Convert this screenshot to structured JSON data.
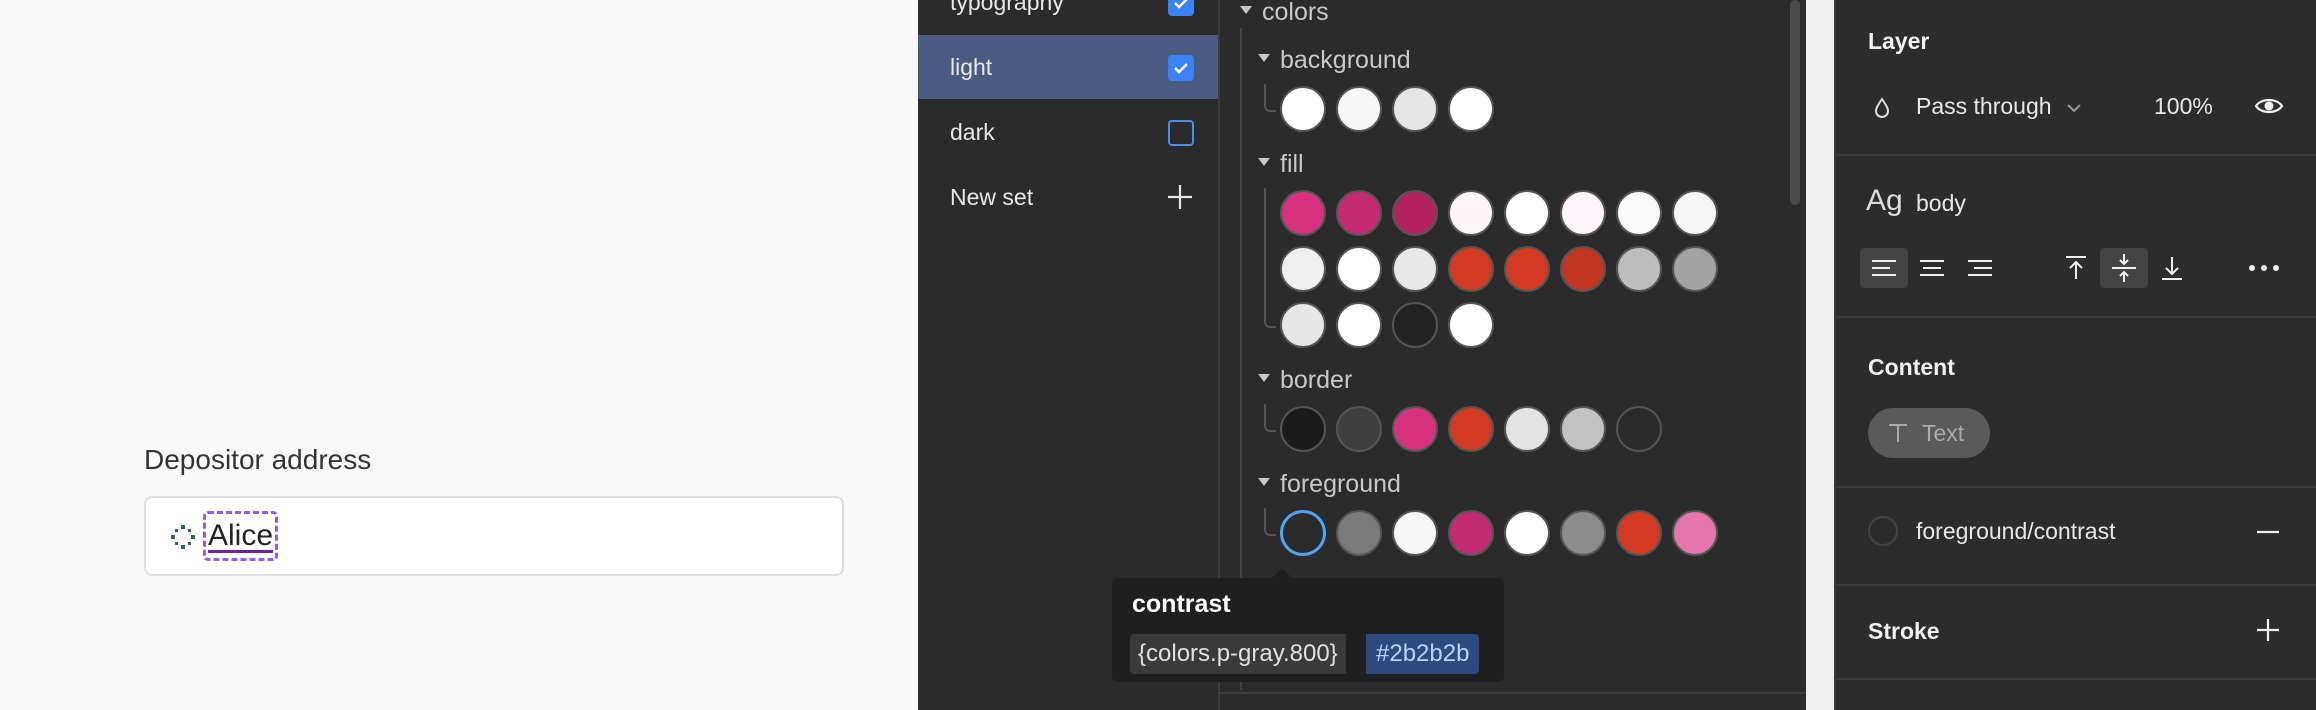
{
  "canvas": {
    "field_label": "Depositor address",
    "field_value": "Alice"
  },
  "token_sets": [
    {
      "label": "typography",
      "checked": true,
      "active": false
    },
    {
      "label": "light",
      "checked": true,
      "active": true
    },
    {
      "label": "dark",
      "checked": false,
      "active": false
    }
  ],
  "new_set_label": "New set",
  "tokens": {
    "root_group": "colors",
    "groups": [
      {
        "name": "background",
        "swatches": [
          "#ffffff",
          "#f7f7f7",
          "#e6e6e6",
          "#ffffff"
        ]
      },
      {
        "name": "fill",
        "swatches": [
          "#d6327d",
          "#c62a72",
          "#b3245f",
          "#fdf6f9",
          "#ffffff",
          "#fdf5f9",
          "#fafafa",
          "#f6f6f6",
          "#efefef",
          "#ffffff",
          "#e9e9e9",
          "#d23a22",
          "#d23a22",
          "#c13522",
          "#bdbdbd",
          "#a3a3a3",
          "#e7e7e7",
          "#ffffff",
          "#222222",
          "#ffffff"
        ]
      },
      {
        "name": "border",
        "swatches": [
          "#1b1b1b",
          "#3f3f3f",
          "#d6327d",
          "#d23a22",
          "#e3e3e3",
          "#c2c2c2",
          "#2b2b2b"
        ]
      },
      {
        "name": "foreground",
        "swatches": [
          "#2b2b2b",
          "#7a7a7a",
          "#f7f7f7",
          "#c22a72",
          "#ffffff",
          "#8c8c8c",
          "#d23a22",
          "#e575ad"
        ],
        "selected_index": 0
      }
    ]
  },
  "tooltip": {
    "title": "contrast",
    "reference": "{colors.p-gray.800}",
    "hex": "#2b2b2b"
  },
  "inspector": {
    "layer_title": "Layer",
    "blend_mode": "Pass through",
    "opacity": "100%",
    "font_glyph": "Ag",
    "text_style": "body",
    "content_title": "Content",
    "content_pill": "Text",
    "fill_token": "foreground/contrast",
    "stroke_title": "Stroke"
  },
  "icons": {
    "field": "component-icon",
    "blend": "drop-icon",
    "visibility": "eye-icon",
    "more": "more-horizontal-icon"
  }
}
